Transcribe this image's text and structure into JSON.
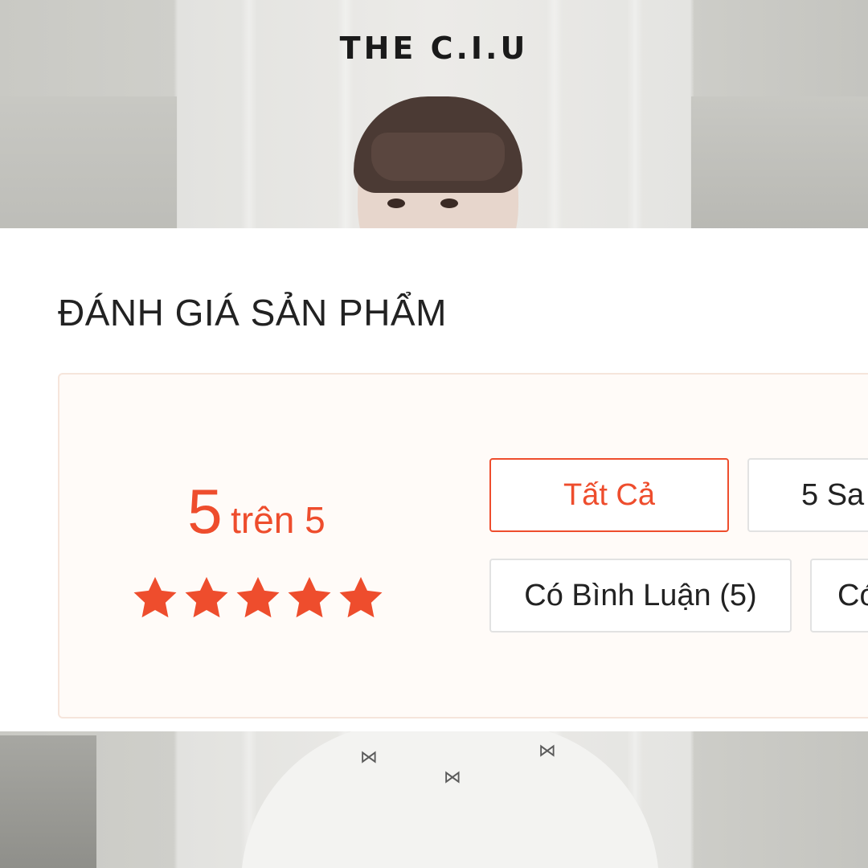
{
  "brand": {
    "logo_text": "THE C.I.U"
  },
  "reviews": {
    "title": "ĐÁNH GIÁ SẢN PHẨM",
    "score": {
      "value": "5",
      "suffix": "trên 5",
      "stars_filled": 5,
      "stars_total": 5
    },
    "filters": [
      {
        "label": "Tất Cả",
        "active": true
      },
      {
        "label": "5 Sa",
        "active": false
      },
      {
        "label": "Có Bình Luận (5)",
        "active": false
      },
      {
        "label": "Có",
        "active": false
      }
    ]
  },
  "colors": {
    "accent": "#ee4d2d",
    "summary_bg": "#fffbf8",
    "border": "#e2e2e2"
  },
  "icons": {
    "rating_star": "star-icon"
  }
}
